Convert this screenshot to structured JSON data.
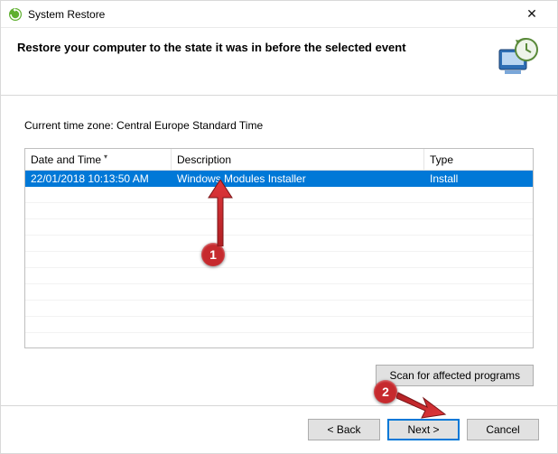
{
  "window_title": "System Restore",
  "headline": "Restore your computer to the state it was in before the selected event",
  "time_zone_label": "Current time zone: Central Europe Standard Time",
  "columns": {
    "date": "Date and Time",
    "desc": "Description",
    "type": "Type"
  },
  "rows": [
    {
      "date": "22/01/2018 10:13:50 AM",
      "desc": "Windows Modules Installer",
      "type": "Install",
      "selected": true
    }
  ],
  "buttons": {
    "scan": "Scan for affected programs",
    "back": "< Back",
    "next": "Next >",
    "cancel": "Cancel"
  },
  "annotations": {
    "marker1": "1",
    "marker2": "2"
  }
}
